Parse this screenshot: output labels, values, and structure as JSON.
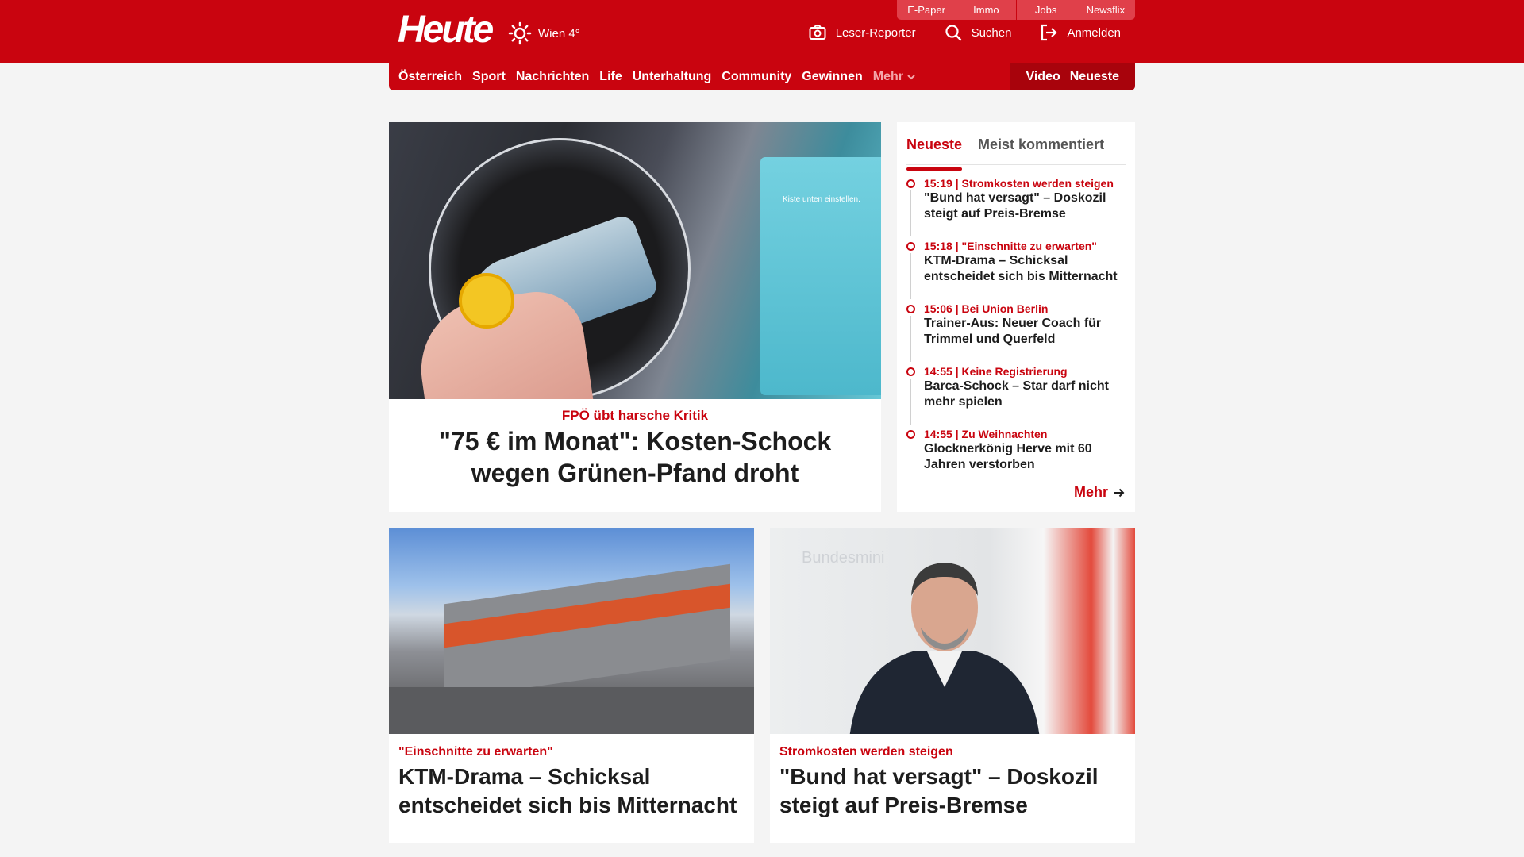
{
  "header": {
    "logo": "Heute",
    "weather": "Wien 4°",
    "top_links": [
      "E-Paper",
      "Immo",
      "Jobs",
      "Newsflix"
    ],
    "actions": [
      {
        "label": "Leser-Reporter",
        "icon": "camera-icon"
      },
      {
        "label": "Suchen",
        "icon": "search-icon"
      },
      {
        "label": "Anmelden",
        "icon": "login-icon"
      }
    ]
  },
  "nav": {
    "items": [
      "Österreich",
      "Sport",
      "Nachrichten",
      "Life",
      "Unterhaltung",
      "Community",
      "Gewinnen"
    ],
    "more": "Mehr",
    "right": [
      "Video",
      "Neueste"
    ]
  },
  "hero": {
    "kicker": "FPÖ übt harsche Kritik",
    "title": "\"75 € im Monat\": Kosten-Schock wegen Grünen-Pfand droht",
    "image_text": "Kiste unten einstellen."
  },
  "ticker": {
    "tabs": [
      "Neueste",
      "Meist kommentiert"
    ],
    "items": [
      {
        "time": "15:19",
        "topic": "Stromkosten werden steigen",
        "headline": "\"Bund hat versagt\" – Doskozil steigt auf Preis-Bremse"
      },
      {
        "time": "15:18",
        "topic": "\"Einschnitte zu erwarten\"",
        "headline": "KTM-Drama – Schicksal entscheidet sich bis Mitternacht"
      },
      {
        "time": "15:06",
        "topic": "Bei Union Berlin",
        "headline": "Trainer-Aus: Neuer Coach für Trimmel und Querfeld"
      },
      {
        "time": "14:55",
        "topic": "Keine Registrierung",
        "headline": "Barca-Schock – Star darf nicht mehr spielen"
      },
      {
        "time": "14:55",
        "topic": "Zu Weihnachten",
        "headline": "Glocknerkönig Herve mit 60 Jahren verstorben"
      }
    ],
    "more": "Mehr"
  },
  "cards": [
    {
      "kicker": "\"Einschnitte zu erwarten\"",
      "title": "KTM-Drama – Schicksal entscheidet sich bis Mitternacht"
    },
    {
      "kicker": "Stromkosten werden steigen",
      "title": "\"Bund hat versagt\" – Doskozil steigt auf Preis-Bremse",
      "image_text": "Bundesmini"
    }
  ],
  "colors": {
    "brand_red": "#c9040f",
    "page_bg": "#f4f4f4"
  }
}
